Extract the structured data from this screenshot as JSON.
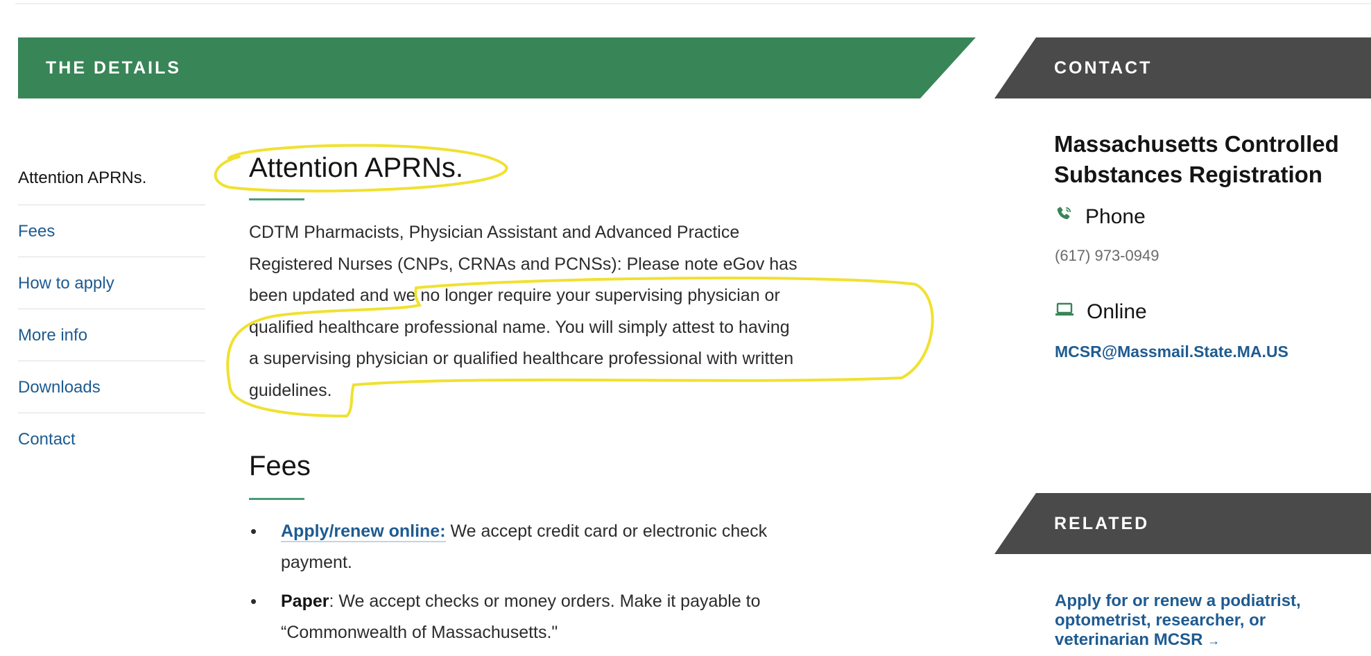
{
  "details_banner": "THE DETAILS",
  "contact_banner": "CONTACT",
  "related_banner": "RELATED",
  "sidebar": {
    "items": [
      {
        "label": "Attention APRNs.",
        "active": true
      },
      {
        "label": "Fees"
      },
      {
        "label": "How to apply"
      },
      {
        "label": "More info"
      },
      {
        "label": "Downloads"
      },
      {
        "label": "Contact"
      }
    ]
  },
  "main": {
    "heading": "Attention APRNs.",
    "paragraph_lines": [
      "CDTM Pharmacists, Physician Assistant and Advanced Practice",
      "Registered Nurses (CNPs, CRNAs and PCNSs): Please note eGov has",
      "been updated and we no longer require your supervising physician or",
      "qualified healthcare professional name. You will simply attest to having",
      "a supervising physician or qualified healthcare professional with written",
      "guidelines."
    ],
    "fees_heading": "Fees",
    "fees": {
      "online_link": "Apply/renew online:",
      "online_text": " We accept credit card or electronic check",
      "online_text2": "payment.",
      "paper_label": "Paper",
      "paper_text": ": We accept checks or money orders. Make it payable to",
      "paper_text2": "“Commonwealth of Massachusetts.\""
    }
  },
  "contact": {
    "org_name": "Massachusetts Controlled Substances Registration",
    "phone_label": "Phone",
    "phone_value": "(617) 973-0949",
    "online_label": "Online",
    "online_value": "MCSR@Massmail.State.MA.US"
  },
  "related": {
    "link_text": "Apply for or renew a podiatrist, optometrist, researcher, or veterinarian MCSR",
    "arrow": "→"
  },
  "colors": {
    "green_banner": "#388557",
    "dark_banner": "#4a4a4a",
    "link_blue": "#1e5b91",
    "highlight_yellow": "#f0e130"
  }
}
